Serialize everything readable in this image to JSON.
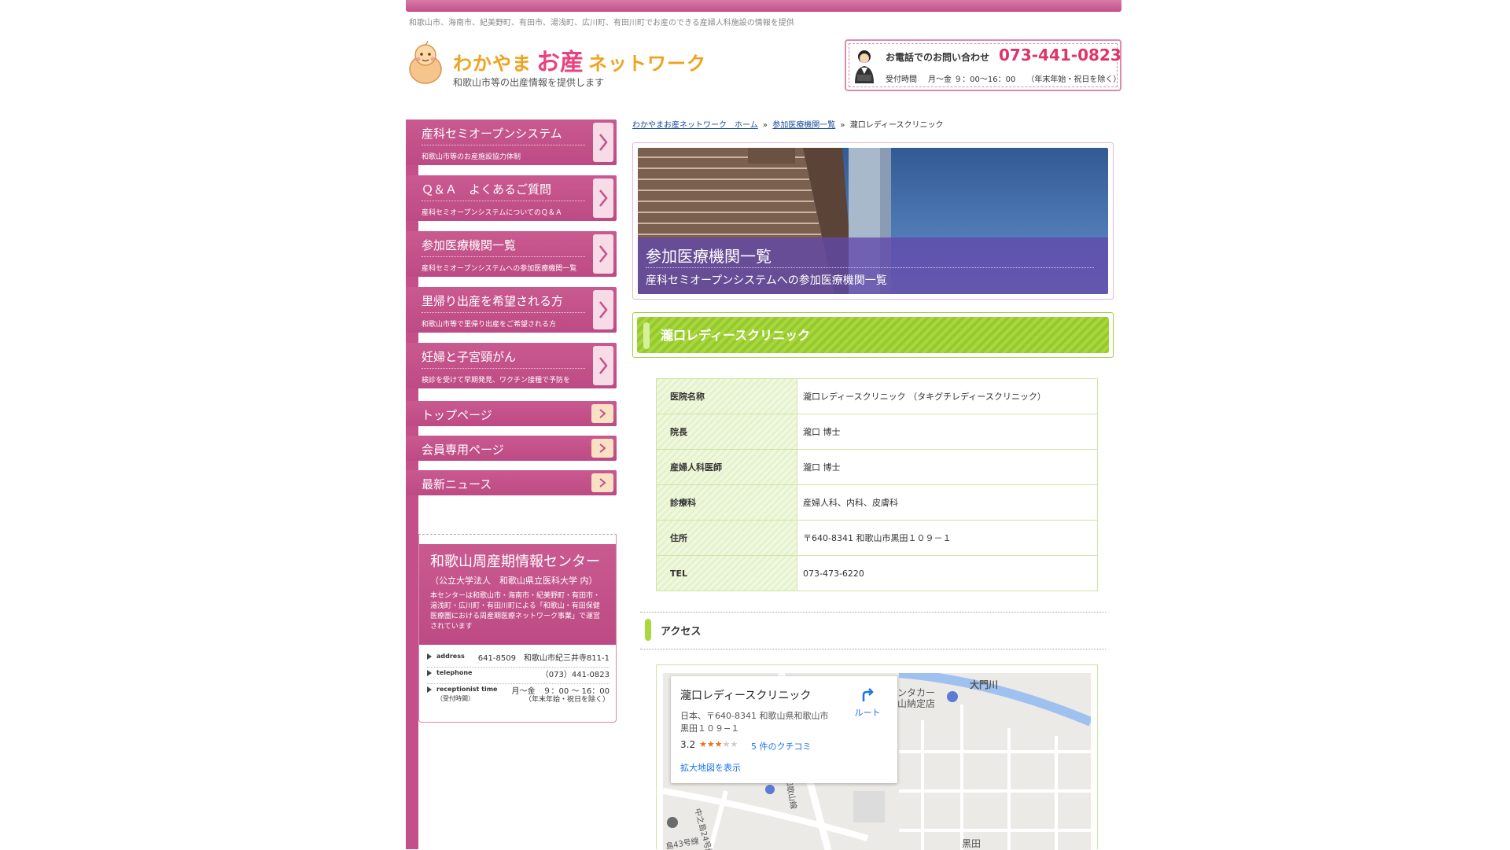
{
  "header": {
    "tagline": "和歌山市、海南市、紀美野町、有田市、湯浅町、広川町、有田川町でお産のできる産婦人科施設の情報を提供",
    "logo_part1": "わかやま",
    "logo_part2": "お産",
    "logo_part3": "ネットワーク",
    "logo_sub": "和歌山市等の出産情報を提供します",
    "contact_label": "お電話でのお問い合わせ",
    "contact_phone": "073-441-0823",
    "contact_hours_label": "受付時間",
    "contact_hours": "月～金 ９：00～16：00",
    "contact_note": "（年末年始・祝日を除く）"
  },
  "sidebar": {
    "nav_large": [
      {
        "title": "産科セミオープンシステム",
        "sub": "和歌山市等のお産施設協力体制"
      },
      {
        "title": "Ｑ＆Ａ　よくあるご質問",
        "sub": "産科セミオープンシステムについてのＱ＆Ａ"
      },
      {
        "title": "参加医療機関一覧",
        "sub": "産科セミオープンシステムへの参加医療機関一覧"
      },
      {
        "title": "里帰り出産を希望される方",
        "sub": "和歌山市等で里帰り出産をご希望される方"
      },
      {
        "title": "妊婦と子宮頸がん",
        "sub": "検診を受けて早期発見、ワクチン接種で予防を"
      }
    ],
    "nav_small": [
      {
        "title": "トップページ"
      },
      {
        "title": "会員専用ページ"
      },
      {
        "title": "最新ニュース"
      }
    ],
    "center": {
      "title": "和歌山周産期情報センター",
      "sub": "（公立大学法人　和歌山県立医科大学 内）",
      "desc": "本センターは和歌山市・海南市・紀美野町・有田市・湯浅町・広川町・有田川町による「和歌山・有田保健医療圏における周産期医療ネットワーク事業」で運営されています",
      "address_label": "address",
      "address": "641-8509　和歌山市紀三井寺811-1",
      "telephone_label": "telephone",
      "telephone": "（073）441-0823",
      "reception_label": "receptionist time",
      "reception_label_jp": "（受付時間）",
      "reception": "月～金　９：00 ～ 16：00",
      "reception_note": "（年末年始・祝日を除く）"
    }
  },
  "breadcrumb": {
    "home": "わかやまお産ネットワーク　ホーム",
    "list": "参加医療機関一覧",
    "current": "瀧口レディースクリニック",
    "separator": "»"
  },
  "hero": {
    "title": "参加医療機関一覧",
    "sub": "産科セミオープンシステムへの参加医療機関一覧"
  },
  "clinic_title": "瀧口レディースクリニック",
  "info_rows": [
    {
      "key": "医院名称",
      "value": "瀧口レディースクリニック （タキグチレディースクリニック）"
    },
    {
      "key": "院長",
      "value": "瀧口 博士"
    },
    {
      "key": "産婦人科医師",
      "value": "瀧口 博士"
    },
    {
      "key": "診療科",
      "value": "産婦人科、内科、皮膚科"
    },
    {
      "key": "住所",
      "value": "〒640-8341 和歌山市黒田１０９－１"
    },
    {
      "key": "TEL",
      "value": "073-473-6220"
    }
  ],
  "access_title": "アクセス",
  "map": {
    "name": "瀧口レディースクリニック",
    "address_line1": "日本、〒640-8341 和歌山県和歌山市",
    "address_line2": "黒田１０９−１",
    "rating": "3.2",
    "rating_value": 3.2,
    "stars_on": "★★★",
    "stars_off": "★★",
    "reviews": "5 件のクチコミ",
    "larger_map": "拡大地図を表示",
    "route": "ルート",
    "label_river": "大門川",
    "label_store1": "ンタカー",
    "label_store2": "山納定店",
    "label_kuroda": "黒田",
    "label_road1": "中之島24号線",
    "label_road2": "和歌山線",
    "label_road3": "島43号線"
  },
  "colors": {
    "pink": "#c4508a",
    "green": "#a8d83c",
    "phone": "#e0336a",
    "link": "#1a4c9c"
  }
}
